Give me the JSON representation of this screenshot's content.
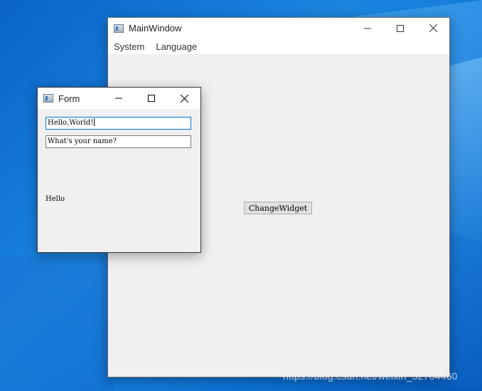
{
  "main_window": {
    "title": "MainWindow",
    "menu": [
      {
        "label": "System"
      },
      {
        "label": "Language"
      }
    ],
    "button_label": "ChangeWidget"
  },
  "form_window": {
    "title": "Form",
    "input1_value": "Hello,World!",
    "input2_value": "What's your name?",
    "label_text": "Hello"
  },
  "watermark": "https://blog.csdn.net/weixin_52704460",
  "icons": {
    "minimize": "minimize-icon",
    "maximize": "maximize-icon",
    "close": "close-icon"
  },
  "colors": {
    "focus_border": "#0078d7",
    "desktop": "#1a86e0"
  }
}
